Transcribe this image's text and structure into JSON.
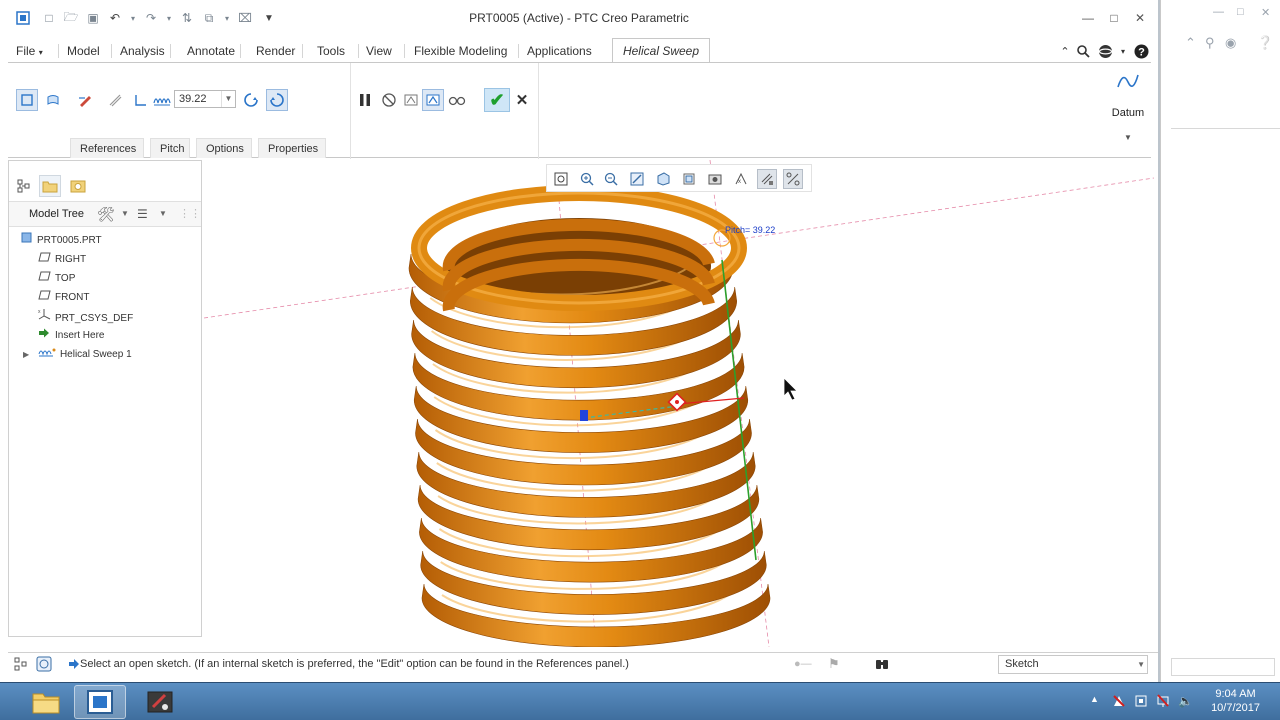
{
  "window": {
    "title": "PRT0005 (Active) - PTC Creo Parametric"
  },
  "quick_access": {
    "icons": [
      "app-icon",
      "new-icon",
      "open-icon",
      "save-icon",
      "undo-icon",
      "redo-icon",
      "regenerate-icon",
      "windows-icon",
      "close-window-icon",
      "customize-icon"
    ]
  },
  "ribbon": {
    "tabs": [
      {
        "label": "File"
      },
      {
        "label": "Model"
      },
      {
        "label": "Analysis"
      },
      {
        "label": "Annotate"
      },
      {
        "label": "Render"
      },
      {
        "label": "Tools"
      },
      {
        "label": "View"
      },
      {
        "label": "Flexible Modeling"
      },
      {
        "label": "Applications"
      },
      {
        "label": "Helical Sweep"
      }
    ],
    "active_tab": "Helical Sweep",
    "pitch_value": "39.22",
    "panels": [
      "References",
      "Pitch",
      "Options",
      "Properties"
    ],
    "datum_label": "Datum"
  },
  "navigator": {
    "header_label": "Model Tree",
    "tree": [
      {
        "label": "PRT0005.PRT",
        "icon": "part-icon"
      },
      {
        "label": "RIGHT",
        "icon": "datum-plane-icon"
      },
      {
        "label": "TOP",
        "icon": "datum-plane-icon"
      },
      {
        "label": "FRONT",
        "icon": "datum-plane-icon"
      },
      {
        "label": "PRT_CSYS_DEF",
        "icon": "csys-icon"
      },
      {
        "label": "Insert Here",
        "icon": "insert-arrow-icon"
      },
      {
        "label": "Helical Sweep 1",
        "icon": "helical-sweep-icon"
      }
    ]
  },
  "graphics": {
    "pitch_annotation": "Pitch= 39.22"
  },
  "status": {
    "message": "Select an open sketch. (If an internal sketch is preferred, the \"Edit\" option can be found in the References panel.)",
    "filter_value": "Sketch"
  },
  "taskbar": {
    "time": "9:04 AM",
    "date": "10/7/2017"
  },
  "colors": {
    "spring": "#e08a12",
    "accent": "#2b75c9",
    "ok_green": "#1fa02e",
    "taskbar": "#4a7eb3"
  }
}
